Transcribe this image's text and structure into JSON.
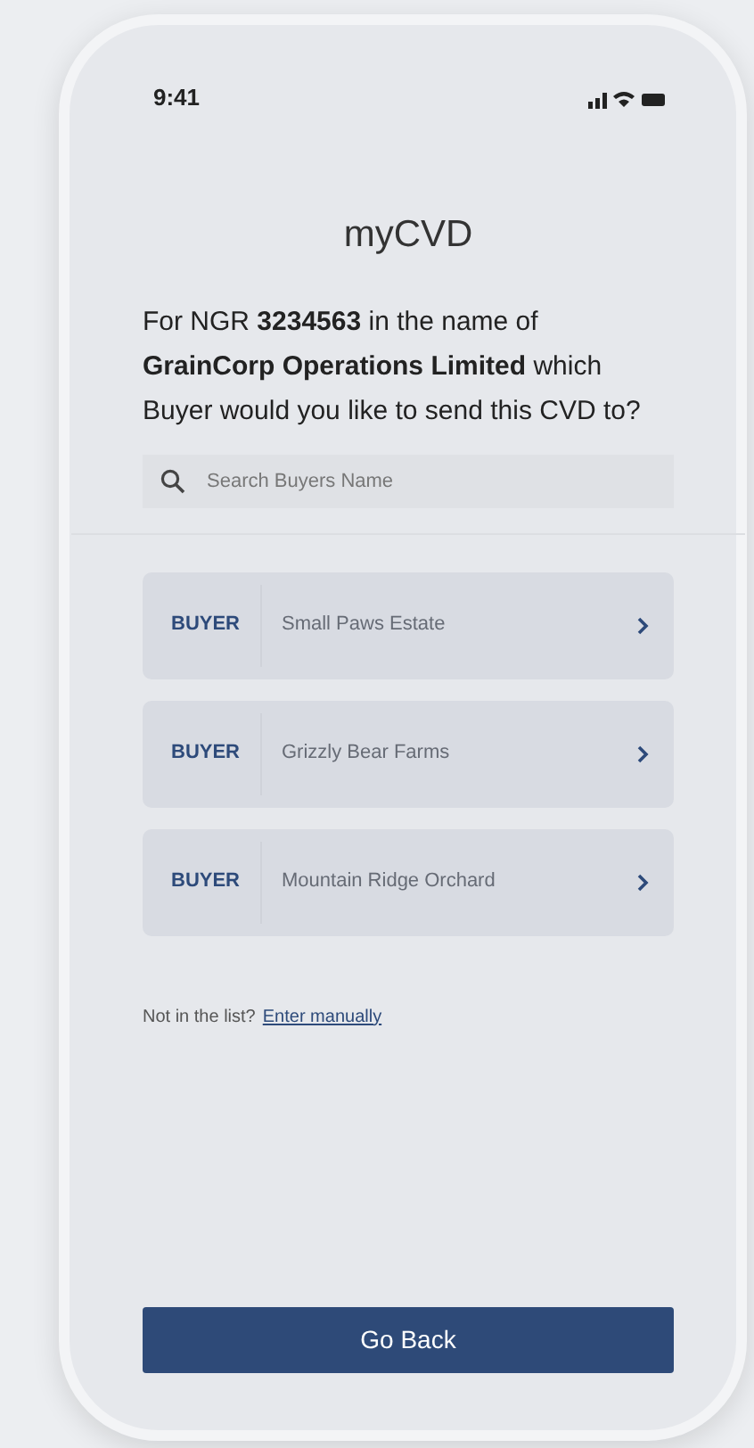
{
  "status_bar": {
    "time": "9:41"
  },
  "title": "myCVD",
  "prompt": "For NGR **3234563** in the name of **GrainCorp Operations Limited** which Buyer would you like to send this CVD to?",
  "search": {
    "placeholder": "Search Buyers Name"
  },
  "buyers": [
    {
      "label": "BUYER",
      "name": "Small Paws Estate"
    },
    {
      "label": "BUYER",
      "name": "Grizzly Bear Farms"
    },
    {
      "label": "BUYER",
      "name": "Mountain Ridge Orchard"
    }
  ],
  "manual": {
    "text": "Not in the list?",
    "link": "Enter manually"
  },
  "button": "Go Back"
}
